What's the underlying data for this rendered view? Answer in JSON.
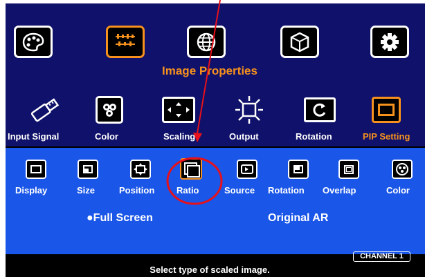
{
  "top_menu": {
    "title": "Image Properties",
    "tiles": [
      {
        "icon": "palette-icon"
      },
      {
        "icon": "image-adjust-icon",
        "active": true
      },
      {
        "icon": "globe-icon"
      },
      {
        "icon": "3d-cube-icon"
      },
      {
        "icon": "gear-icon"
      }
    ]
  },
  "categories": [
    {
      "label": "Input Signal",
      "icon": "usb-plug-icon"
    },
    {
      "label": "Color",
      "icon": "color-dots-icon"
    },
    {
      "label": "Scaling",
      "icon": "scaling-arrows-icon"
    },
    {
      "label": "Output",
      "icon": "sun-output-icon"
    },
    {
      "label": "Rotation",
      "icon": "rotation-icon"
    },
    {
      "label": "PIP Setting",
      "icon": "pip-icon",
      "active": true
    }
  ],
  "submenu": [
    {
      "label": "Display",
      "icon": "display-icon"
    },
    {
      "label": "Size",
      "icon": "size-icon"
    },
    {
      "label": "Position",
      "icon": "position-icon"
    },
    {
      "label": "Ratio",
      "icon": "ratio-icon",
      "active": true
    },
    {
      "label": "Source",
      "icon": "source-icon"
    },
    {
      "label": "Rotation",
      "icon": "rotation-icon"
    },
    {
      "label": "Overlap",
      "icon": "overlap-icon"
    },
    {
      "label": "Color",
      "icon": "color-icon"
    }
  ],
  "options": [
    {
      "label": "Full Screen",
      "selected": true
    },
    {
      "label": "Original AR",
      "selected": false
    }
  ],
  "status": {
    "channel": "CHANNEL 1",
    "hint": "Select type of scaled image."
  },
  "colors": {
    "top_panel": "#10116a",
    "sub_panel": "#1a56e8",
    "accent_orange": "#f6911d",
    "annotation_red": "#e8101a"
  }
}
